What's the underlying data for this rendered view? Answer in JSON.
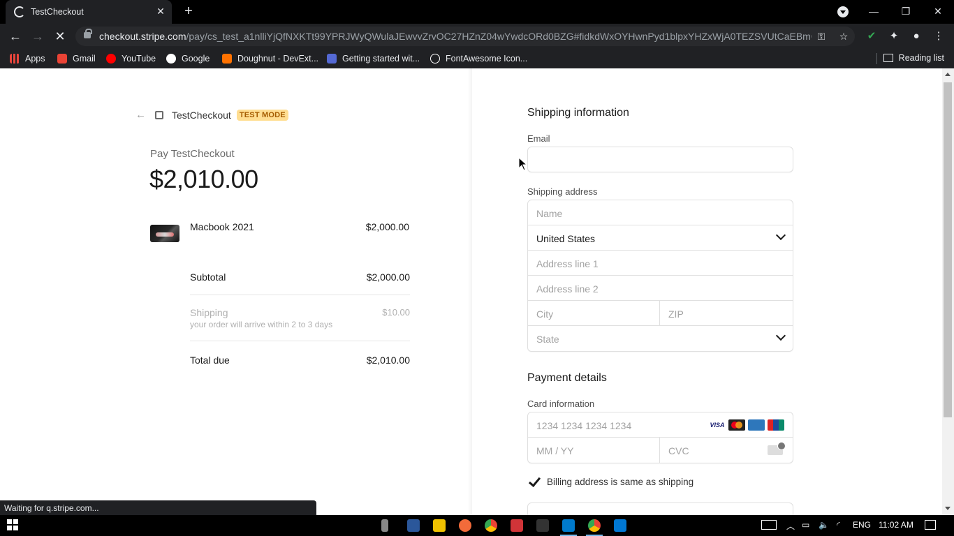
{
  "browser": {
    "tab_title": "TestCheckout",
    "url_host": "checkout.stripe.com",
    "url_path": "/pay/cs_test_a1nlliYjQfNXKTt99YPRJWyQWulaJEwvvZrvOC27HZnZ04wYwdcORd0BZG#fidkdWxOYHwnPyd1blpxYHZxWjA0TEZSVUtCaEBmQGh...",
    "bookmarks": [
      {
        "label": "Apps",
        "icon": "apps-grid-icon",
        "color": "#e8453c"
      },
      {
        "label": "Gmail",
        "icon": "gmail-icon",
        "color": "#ea4335"
      },
      {
        "label": "YouTube",
        "icon": "youtube-icon",
        "color": "#ff0000"
      },
      {
        "label": "Google",
        "icon": "google-icon",
        "color": "#4285f4"
      },
      {
        "label": "Doughnut - DevExt...",
        "icon": "devextreme-icon",
        "color": "#ff7200"
      },
      {
        "label": "Getting started wit...",
        "icon": "stripe-docs-icon",
        "color": "#5469d4"
      },
      {
        "label": "FontAwesome Icon...",
        "icon": "fontawesome-icon",
        "color": "#ffffff"
      }
    ],
    "reading_list": "Reading list",
    "status_text": "Waiting for q.stripe.com..."
  },
  "checkout": {
    "merchant": "TestCheckout",
    "test_mode_badge": "TEST MODE",
    "pay_label": "Pay TestCheckout",
    "amount": "$2,010.00",
    "line_items": [
      {
        "name": "Macbook 2021",
        "price": "$2,000.00"
      }
    ],
    "subtotal_label": "Subtotal",
    "subtotal": "$2,000.00",
    "shipping_label": "Shipping",
    "shipping_note": "your order will arrive within 2 to 3 days",
    "shipping": "$10.00",
    "total_label": "Total due",
    "total": "$2,010.00"
  },
  "form": {
    "shipping_title": "Shipping information",
    "email_label": "Email",
    "email_value": "",
    "address_label": "Shipping address",
    "name_placeholder": "Name",
    "country_value": "United States",
    "address1_placeholder": "Address line 1",
    "address2_placeholder": "Address line 2",
    "city_placeholder": "City",
    "zip_placeholder": "ZIP",
    "state_placeholder": "State",
    "payment_title": "Payment details",
    "card_label": "Card information",
    "card_number_placeholder": "1234 1234 1234 1234",
    "card_brands": [
      "VISA",
      "Mastercard",
      "AMEX",
      "UnionPay"
    ],
    "expiry_placeholder": "MM / YY",
    "cvc_placeholder": "CVC",
    "billing_same_label": "Billing address is same as shipping",
    "billing_same_checked": true
  },
  "taskbar": {
    "language": "ENG",
    "time": "11:02 AM"
  },
  "colors": {
    "test_mode_bg": "#ffde92",
    "test_mode_text": "#a55c00"
  }
}
